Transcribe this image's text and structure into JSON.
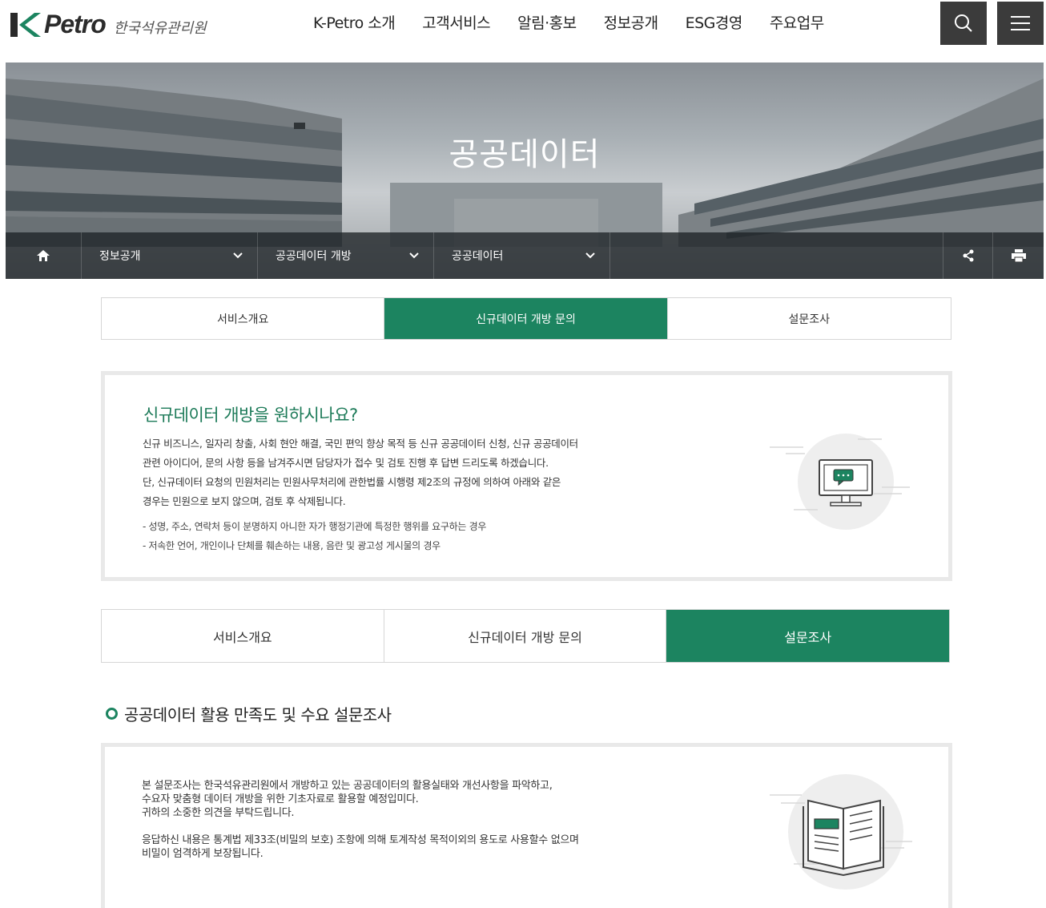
{
  "header": {
    "logo_text": "Petro",
    "logo_kor": "한국석유관리원",
    "nav": [
      "K-Petro 소개",
      "고객서비스",
      "알림·홍보",
      "정보공개",
      "ESG경영",
      "주요업무"
    ],
    "search_icon": "search-icon",
    "menu_icon": "hamburger-menu-icon"
  },
  "hero": {
    "title": "공공데이터"
  },
  "location": {
    "home_icon": "home-icon",
    "items": [
      "정보공개",
      "공공데이터 개방",
      "공공데이터"
    ],
    "share_icon": "share-icon",
    "print_icon": "print-icon"
  },
  "tabs_top": {
    "items": [
      "서비스개요",
      "신규데이터 개방 문의",
      "설문조사"
    ],
    "active": 1
  },
  "inquiry_box": {
    "title": "신규데이터 개방을 원하시나요?",
    "lines": [
      "신규 비즈니스, 일자리 창출, 사회 현안 해결, 국민 편익 향상 목적 등 신규 공공데이터 신청, 신규 공공데이터",
      "관련 아이디어, 문의 사항 등을 남겨주시면 담당자가 접수 및 검토 진행 후 답변 드리도록 하겠습니다.",
      "단, 신규데이터 요청의 민원처리는 민원사무처리에 관한법률 시행령 제2조의 규정에 의하여 아래와 같은",
      "경우는 민원으로 보지 않으며, 검토 후 삭제됩니다."
    ],
    "bullets": [
      "- 성명, 주소, 연락처 등이 분명하지 아니한 자가 행정기관에 특정한 행위를 요구하는 경우",
      "- 저속한 언어, 개인이나 단체를 훼손하는 내용, 음란 및 광고성 게시물의 경우"
    ],
    "icon": "monitor-chat-icon"
  },
  "tabs_bottom": {
    "items": [
      "서비스개요",
      "신규데이터 개방 문의",
      "설문조사"
    ],
    "active": 2
  },
  "survey": {
    "section_title": "공공데이터 활용 만족도 및 수요 설문조사",
    "lines": [
      "본 설문조사는 한국석유관리원에서 개방하고 있는 공공데이터의 활용실태와 개선사항을 파악하고,",
      "수요자 맞춤형 데이터 개방을 위한 기초자료로 활용할 예정입미다.",
      "귀하의 소중한 의견을 부탁드립니다."
    ],
    "lines2": [
      "응답하신 내용은 통계법 제33조(비밀의 보호) 조항에 의해 토계작성 목적이외의 용도로 사용할수 없으며",
      "비밀이 엄격하게 보장됩니다."
    ],
    "icon": "open-book-icon"
  },
  "colors": {
    "accent": "#1c8460",
    "title_green": "#1c7a58",
    "header_button": "#3b3b3b"
  }
}
